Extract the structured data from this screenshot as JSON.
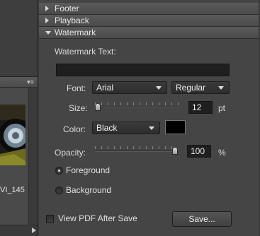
{
  "left_panel": {
    "thumbnail_label": "VI_145"
  },
  "sections": [
    {
      "label": "Footer",
      "expanded": false
    },
    {
      "label": "Playback",
      "expanded": false
    },
    {
      "label": "Watermark",
      "expanded": true
    }
  ],
  "watermark": {
    "title": "Watermark Text:",
    "text_value": "",
    "font_label": "Font:",
    "font_value": "Arial",
    "style_value": "Regular",
    "size_label": "Size:",
    "size_value": "12",
    "size_unit": "pt",
    "size_slider_fraction": 0.02,
    "color_label": "Color:",
    "color_value": "Black",
    "color_swatch": "#000000",
    "opacity_label": "Opacity:",
    "opacity_value": "100",
    "opacity_unit": "%",
    "opacity_slider_fraction": 1.0,
    "layer_options": [
      {
        "label": "Foreground",
        "selected": true
      },
      {
        "label": "Background",
        "selected": false
      }
    ]
  },
  "footer_bar": {
    "view_pdf_label": "View PDF After Save",
    "view_pdf_checked": false,
    "save_label": "Save..."
  }
}
